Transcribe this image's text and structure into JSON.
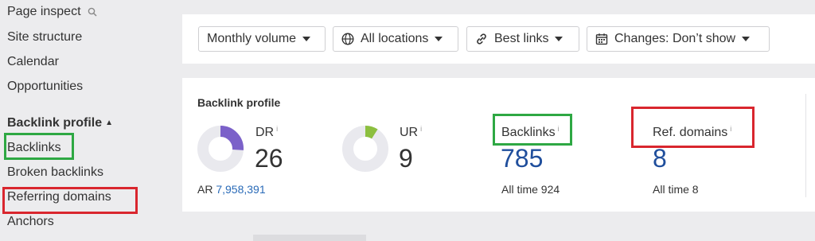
{
  "sidebar": {
    "page_inspect": "Page inspect",
    "site_structure": "Site structure",
    "calendar": "Calendar",
    "opportunities": "Opportunities",
    "backlink_profile_header": "Backlink profile",
    "backlinks": "Backlinks",
    "broken_backlinks": "Broken backlinks",
    "referring_domains": "Referring domains",
    "anchors": "Anchors"
  },
  "filters": {
    "volume": "Monthly volume",
    "locations": "All locations",
    "links": "Best links",
    "changes": "Changes: Don’t show"
  },
  "profile": {
    "title": "Backlink profile",
    "dr_label": "DR",
    "dr_value": "26",
    "dr_fraction": 0.26,
    "ar_label": "AR",
    "ar_value": "7,958,391",
    "ur_label": "UR",
    "ur_value": "9",
    "ur_fraction": 0.09,
    "backlinks_label": "Backlinks",
    "backlinks_value": "785",
    "backlinks_alltime_label": "All time",
    "backlinks_alltime_value": "924",
    "refdomains_label": "Ref. domains",
    "refdomains_value": "8",
    "refdomains_alltime_label": "All time",
    "refdomains_alltime_value": "8",
    "info_mark": "i"
  },
  "colors": {
    "dr_arc": "#7b61c9",
    "ur_arc": "#8cbf3f",
    "donut_track": "#e9e9ee",
    "highlight_green": "#2ea843",
    "highlight_red": "#d9262e",
    "link_blue": "#1f4e9c"
  }
}
